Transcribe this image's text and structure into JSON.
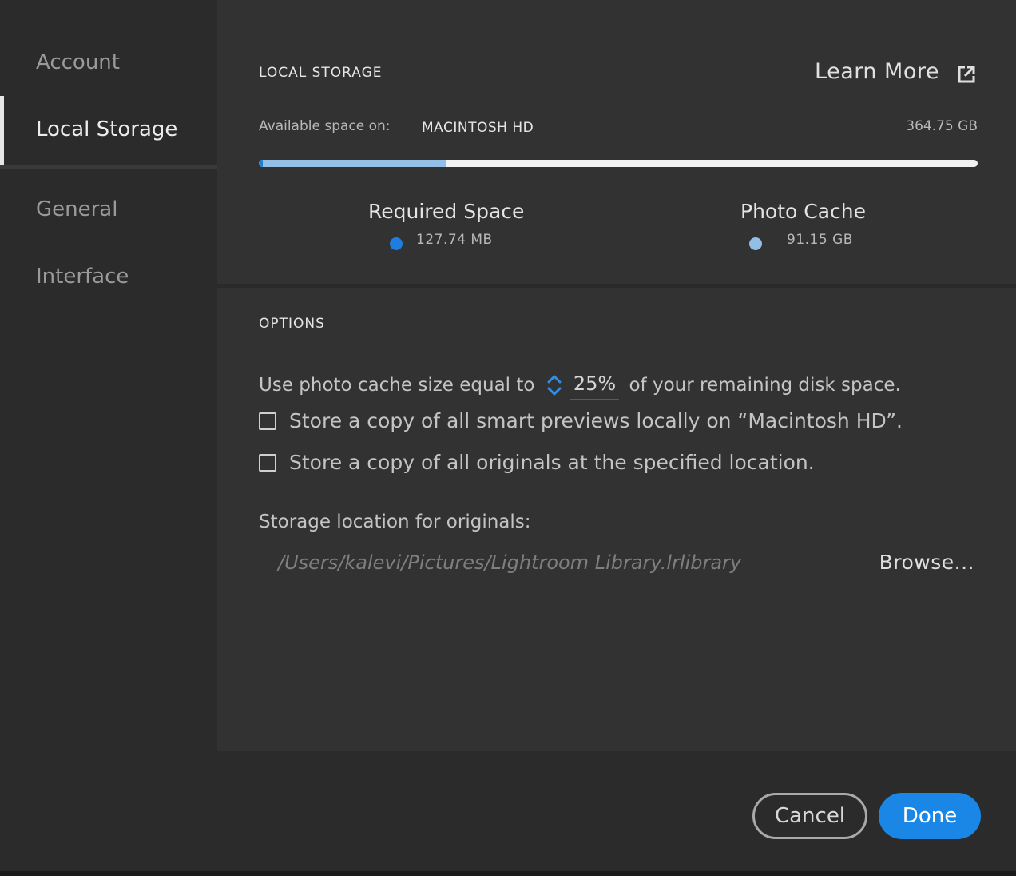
{
  "sidebar": {
    "items": [
      {
        "label": "Account",
        "active": false
      },
      {
        "label": "Local Storage",
        "active": true
      },
      {
        "label": "General",
        "active": false
      },
      {
        "label": "Interface",
        "active": false
      }
    ]
  },
  "local_storage": {
    "title": "LOCAL STORAGE",
    "learn_more": "Learn More",
    "learn_more_icon": "external-link-icon",
    "available_label": "Available space on:",
    "drive_name": "MACINTOSH HD",
    "drive_size": "364.75 GB",
    "usage": {
      "required_fraction": 0.005,
      "cache_fraction": 0.26
    },
    "legend": [
      {
        "title": "Required Space",
        "value": "127.74 MB",
        "color": "#1e7ee0"
      },
      {
        "title": "Photo Cache",
        "value": "91.15 GB",
        "color": "#93bee6"
      }
    ]
  },
  "options": {
    "title": "OPTIONS",
    "cache_before": "Use photo cache size equal to",
    "cache_value": "25%",
    "cache_after": "of your remaining disk space.",
    "checkbox_previews": "Store a copy of all smart previews locally on “Macintosh HD”.",
    "checkbox_originals": "Store a copy of all originals at the specified location.",
    "storage_label": "Storage location for originals:",
    "storage_path": "/Users/kalevi/Pictures/Lightroom Library.lrlibrary",
    "browse": "Browse..."
  },
  "footer": {
    "cancel": "Cancel",
    "done": "Done"
  },
  "colors": {
    "accent": "#1a86e6",
    "cache_bar": "#93bee6",
    "required_bar": "#1e7ee0"
  }
}
